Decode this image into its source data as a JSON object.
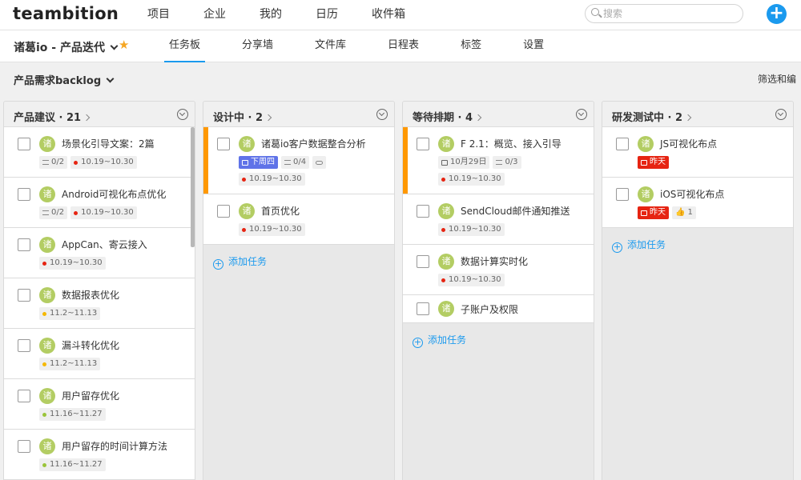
{
  "app": {
    "logo": "teambition",
    "nav": [
      "项目",
      "企业",
      "我的",
      "日历",
      "收件箱"
    ],
    "search_placeholder": "搜索",
    "add_label": "+"
  },
  "project": {
    "name": "诸葛io - 产品迭代",
    "tabs": [
      "任务板",
      "分享墙",
      "文件库",
      "日程表",
      "标签",
      "设置"
    ],
    "active_tab": "任务板"
  },
  "subbar": {
    "backlog": "产品需求backlog",
    "filter": "筛选和编"
  },
  "colors": {
    "accent": "#1b9aee",
    "flag": "#ff9800",
    "avatar": "#b3cd63",
    "overdue": "#e62412",
    "next_week": "#5f73e8"
  },
  "columns": [
    {
      "title": "产品建议 · 21",
      "cards": [
        {
          "avatar": "诸",
          "title": "场景化引导文案：2篇",
          "sub": "0/2",
          "date": "10.19~10.30",
          "dot": "red"
        },
        {
          "avatar": "诸",
          "title": "Android可视化布点优化",
          "sub": "0/2",
          "date": "10.19~10.30",
          "dot": "red"
        },
        {
          "avatar": "诸",
          "title": "AppCan、寄云接入",
          "date": "10.19~10.30",
          "dot": "red"
        },
        {
          "avatar": "诸",
          "title": "数据报表优化",
          "date": "11.2~11.13",
          "dot": "yellow"
        },
        {
          "avatar": "诸",
          "title": "漏斗转化优化",
          "date": "11.2~11.13",
          "dot": "yellow"
        },
        {
          "avatar": "诸",
          "title": "用户留存优化",
          "date": "11.16~11.27",
          "dot": "green"
        },
        {
          "avatar": "诸",
          "title": "用户留存的时间计算方法",
          "date": "11.16~11.27",
          "dot": "green"
        }
      ]
    },
    {
      "title": "设计中 · 2",
      "add_task": "添加任务",
      "cards": [
        {
          "avatar": "诸",
          "title": "诸葛io客户数据整合分析",
          "due": "下周四",
          "sub": "0/4",
          "date": "10.19~10.30",
          "dot": "red",
          "flag": true
        },
        {
          "avatar": "诸",
          "title": "首页优化",
          "date": "10.19~10.30",
          "dot": "red"
        }
      ]
    },
    {
      "title": "等待排期 · 4",
      "add_task": "添加任务",
      "cards": [
        {
          "avatar": "诸",
          "title": "F 2.1：概览、接入引导",
          "cal": "10月29日",
          "sub": "0/3",
          "date": "10.19~10.30",
          "dot": "red",
          "flag": true
        },
        {
          "avatar": "诸",
          "title": "SendCloud邮件通知推送",
          "date": "10.19~10.30",
          "dot": "red"
        },
        {
          "avatar": "诸",
          "title": "数据计算实时化",
          "date": "10.19~10.30",
          "dot": "red"
        },
        {
          "avatar": "诸",
          "title": "子账户及权限"
        }
      ]
    },
    {
      "title": "研发测试中 · 2",
      "add_task": "添加任务",
      "cards": [
        {
          "avatar": "诸",
          "title": "JS可视化布点",
          "overdue": "昨天"
        },
        {
          "avatar": "诸",
          "title": "iOS可视化布点",
          "overdue": "昨天",
          "likes": "1"
        }
      ]
    }
  ]
}
